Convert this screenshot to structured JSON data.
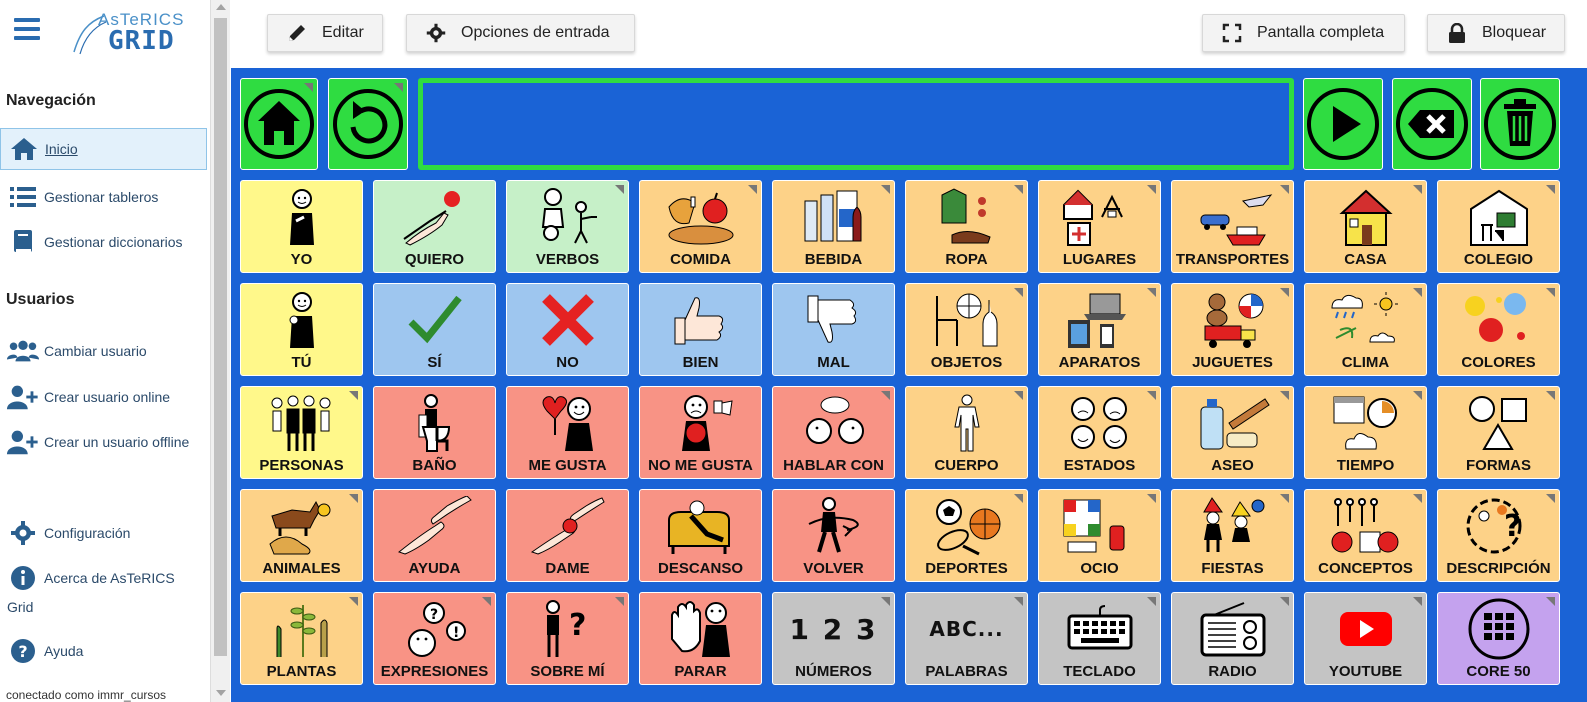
{
  "sidebar": {
    "logo_top": "AsTeRICS",
    "logo_bottom": "GRID",
    "nav_heading": "Navegación",
    "nav_items": [
      {
        "label": "Inicio",
        "icon": "home-icon"
      },
      {
        "label": "Gestionar tableros",
        "icon": "list-icon"
      },
      {
        "label": "Gestionar diccionarios",
        "icon": "book-icon"
      }
    ],
    "users_heading": "Usuarios",
    "user_items": [
      {
        "label": "Cambiar usuario",
        "icon": "users-icon"
      },
      {
        "label": "Crear usuario online",
        "icon": "user-plus-icon"
      },
      {
        "label": "Crear un usuario offline",
        "icon": "user-plus-icon"
      }
    ],
    "other_items": [
      {
        "label": "Configuración",
        "icon": "gear-icon"
      },
      {
        "label": "Acerca de AsTeRICS",
        "cont": "Grid",
        "icon": "info-icon"
      },
      {
        "label": "Ayuda",
        "icon": "question-icon"
      }
    ],
    "footer": "conectado como immr_cursos"
  },
  "toolbar": {
    "edit_label": "Editar",
    "input_options_label": "Opciones de entrada",
    "fullscreen_label": "Pantalla completa",
    "lock_label": "Bloquear"
  },
  "colors": {
    "grid_bg": "#1a63d6",
    "control_green": "#2fdc41",
    "yellow": "#fff88a",
    "green": "#c6f0c8",
    "orange": "#fdd288",
    "blue": "#9ec6ef",
    "red": "#f89385",
    "grey": "#c4c4c4",
    "purple": "#c4a2ee"
  },
  "controls": [
    {
      "icon": "home-icon"
    },
    {
      "icon": "undo-icon"
    },
    {
      "icon": "play-icon"
    },
    {
      "icon": "backspace-icon"
    },
    {
      "icon": "trash-icon"
    }
  ],
  "grid": {
    "rows": [
      [
        {
          "label": "YO",
          "color": "yellow",
          "icon": "person-me-icon",
          "folder": false
        },
        {
          "label": "QUIERO",
          "color": "green",
          "icon": "hand-reach-icon",
          "folder": false
        },
        {
          "label": "VERBOS",
          "color": "green",
          "icon": "actions-icon",
          "folder": true
        },
        {
          "label": "COMIDA",
          "color": "orange",
          "icon": "food-icon",
          "folder": true
        },
        {
          "label": "BEBIDA",
          "color": "orange",
          "icon": "drinks-icon",
          "folder": true
        },
        {
          "label": "ROPA",
          "color": "orange",
          "icon": "clothes-icon",
          "folder": true
        },
        {
          "label": "LUGARES",
          "color": "orange",
          "icon": "places-icon",
          "folder": true
        },
        {
          "label": "TRANSPORTES",
          "color": "orange",
          "icon": "transport-icon",
          "folder": true
        },
        {
          "label": "CASA",
          "color": "orange",
          "icon": "house-icon",
          "folder": true
        },
        {
          "label": "COLEGIO",
          "color": "orange",
          "icon": "school-icon",
          "folder": true
        }
      ],
      [
        {
          "label": "TÚ",
          "color": "yellow",
          "icon": "person-you-icon",
          "folder": false
        },
        {
          "label": "SÍ",
          "color": "blue",
          "icon": "check-icon",
          "folder": false
        },
        {
          "label": "NO",
          "color": "blue",
          "icon": "cross-icon",
          "folder": false
        },
        {
          "label": "BIEN",
          "color": "blue",
          "icon": "thumbs-up-icon",
          "folder": false
        },
        {
          "label": "MAL",
          "color": "blue",
          "icon": "thumbs-down-icon",
          "folder": false
        },
        {
          "label": "OBJETOS",
          "color": "orange",
          "icon": "objects-icon",
          "folder": true
        },
        {
          "label": "APARATOS",
          "color": "orange",
          "icon": "devices-icon",
          "folder": true
        },
        {
          "label": "JUGUETES",
          "color": "orange",
          "icon": "toys-icon",
          "folder": true
        },
        {
          "label": "CLIMA",
          "color": "orange",
          "icon": "weather-icon",
          "folder": true
        },
        {
          "label": "COLORES",
          "color": "orange",
          "icon": "colors-icon",
          "folder": true
        }
      ],
      [
        {
          "label": "PERSONAS",
          "color": "yellow",
          "icon": "people-icon",
          "folder": true
        },
        {
          "label": "BAÑO",
          "color": "red",
          "icon": "toilet-icon",
          "folder": false
        },
        {
          "label": "ME GUSTA",
          "color": "red",
          "icon": "like-icon",
          "folder": false
        },
        {
          "label": "NO ME GUSTA",
          "color": "red",
          "icon": "dislike-icon",
          "folder": false
        },
        {
          "label": "HABLAR CON",
          "color": "red",
          "icon": "talk-icon",
          "folder": true
        },
        {
          "label": "CUERPO",
          "color": "orange",
          "icon": "body-icon",
          "folder": true
        },
        {
          "label": "ESTADOS",
          "color": "orange",
          "icon": "moods-icon",
          "folder": true
        },
        {
          "label": "ASEO",
          "color": "orange",
          "icon": "hygiene-icon",
          "folder": true
        },
        {
          "label": "TIEMPO",
          "color": "orange",
          "icon": "time-icon",
          "folder": true
        },
        {
          "label": "FORMAS",
          "color": "orange",
          "icon": "shapes-icon",
          "folder": true
        }
      ],
      [
        {
          "label": "ANIMALES",
          "color": "orange",
          "icon": "animals-icon",
          "folder": true
        },
        {
          "label": "AYUDA",
          "color": "red",
          "icon": "help-hands-icon",
          "folder": false
        },
        {
          "label": "DAME",
          "color": "red",
          "icon": "give-icon",
          "folder": false
        },
        {
          "label": "DESCANSO",
          "color": "red",
          "icon": "rest-icon",
          "folder": false
        },
        {
          "label": "VOLVER",
          "color": "red",
          "icon": "turn-back-icon",
          "folder": false
        },
        {
          "label": "DEPORTES",
          "color": "orange",
          "icon": "sports-icon",
          "folder": true
        },
        {
          "label": "OCIO",
          "color": "orange",
          "icon": "leisure-icon",
          "folder": true
        },
        {
          "label": "FIESTAS",
          "color": "orange",
          "icon": "party-icon",
          "folder": true
        },
        {
          "label": "CONCEPTOS",
          "color": "orange",
          "icon": "concepts-icon",
          "folder": true
        },
        {
          "label": "DESCRIPCIÓN",
          "color": "orange",
          "icon": "description-icon",
          "folder": true
        }
      ],
      [
        {
          "label": "PLANTAS",
          "color": "orange",
          "icon": "plants-icon",
          "folder": true
        },
        {
          "label": "EXPRESIONES",
          "color": "red",
          "icon": "expressions-icon",
          "folder": true
        },
        {
          "label": "SOBRE MÍ",
          "color": "red",
          "icon": "about-me-icon",
          "folder": true
        },
        {
          "label": "PARAR",
          "color": "red",
          "icon": "stop-hand-icon",
          "folder": false
        },
        {
          "label": "NÚMEROS",
          "color": "grey",
          "icon": "numbers-icon",
          "pict_text": "1 2 3",
          "folder": true
        },
        {
          "label": "PALABRAS",
          "color": "grey",
          "icon": "letters-icon",
          "pict_text": "ABC...",
          "folder": true
        },
        {
          "label": "TECLADO",
          "color": "grey",
          "icon": "keyboard-icon",
          "folder": true
        },
        {
          "label": "RADIO",
          "color": "grey",
          "icon": "radio-icon",
          "folder": true
        },
        {
          "label": "YOUTUBE",
          "color": "grey",
          "icon": "youtube-icon",
          "folder": true
        },
        {
          "label": "CORE 50",
          "color": "purple",
          "icon": "core-grid-icon",
          "folder": true
        }
      ]
    ]
  }
}
